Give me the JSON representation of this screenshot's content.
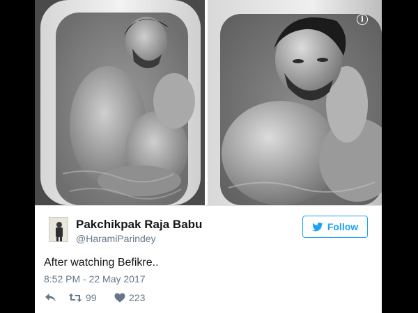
{
  "tweet": {
    "display_name": "Pakchikpak Raja Babu",
    "handle": "@HaramiParindey",
    "text": "After watching Befikre..",
    "timestamp": "8:52 PM - 22 May 2017",
    "follow_label": "Follow",
    "retweet_count": "99",
    "like_count": "223"
  },
  "media": {
    "info_icon_glyph": "i",
    "left_image_icon": "photo",
    "right_image_icon": "photo"
  },
  "icons": {
    "info": "info-icon",
    "follow_bird": "twitter-bird-icon",
    "reply": "reply-icon",
    "retweet": "retweet-icon",
    "like": "heart-icon"
  },
  "colors": {
    "brand_blue": "#1da1f2",
    "text_primary": "#14171a",
    "text_secondary": "#657786",
    "background": "#000000",
    "card": "#ffffff"
  }
}
